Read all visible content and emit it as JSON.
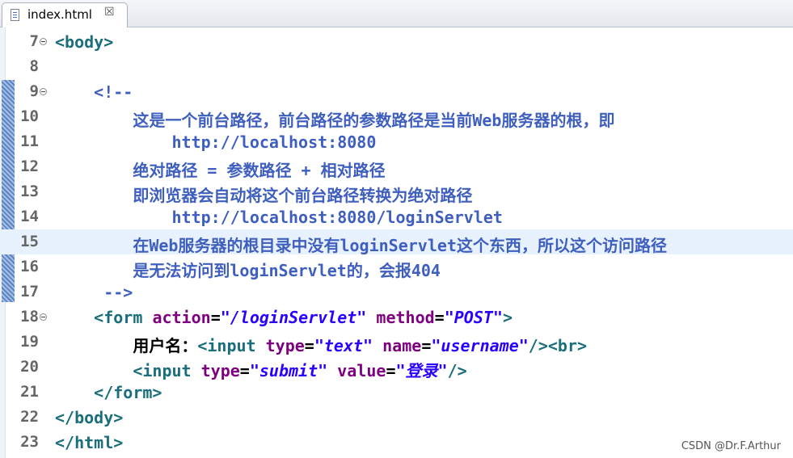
{
  "tab": {
    "label": "index.html",
    "close_glyph": "☒",
    "icon": "html-file-icon"
  },
  "lines": [
    {
      "num": "7",
      "fold": true
    },
    {
      "num": "8",
      "fold": false
    },
    {
      "num": "9",
      "fold": true
    },
    {
      "num": "10",
      "fold": false
    },
    {
      "num": "11",
      "fold": false
    },
    {
      "num": "12",
      "fold": false
    },
    {
      "num": "13",
      "fold": false
    },
    {
      "num": "14",
      "fold": false
    },
    {
      "num": "15",
      "fold": false,
      "current": true
    },
    {
      "num": "16",
      "fold": false
    },
    {
      "num": "17",
      "fold": false
    },
    {
      "num": "18",
      "fold": true
    },
    {
      "num": "19",
      "fold": false
    },
    {
      "num": "20",
      "fold": false
    },
    {
      "num": "21",
      "fold": false
    },
    {
      "num": "22",
      "fold": false
    },
    {
      "num": "23",
      "fold": false
    }
  ],
  "code": {
    "l7": {
      "open": "<body>"
    },
    "l9": {
      "comment_open": "<!--"
    },
    "l10": {
      "text": "这是一个前台路径，前台路径的参数路径是当前Web服务器的根，即"
    },
    "l11": {
      "text": "http://localhost:8080"
    },
    "l12": {
      "text": "绝对路径 = 参数路径 + 相对路径"
    },
    "l13": {
      "text": "即浏览器会自动将这个前台路径转换为绝对路径"
    },
    "l14": {
      "text": "http://localhost:8080/loginServlet"
    },
    "l15": {
      "text": "在Web服务器的根目录中没有loginServlet这个东西，所以这个访问路径"
    },
    "l16": {
      "text": "是无法访问到loginServlet的，会报404"
    },
    "l17": {
      "comment_close": "-->"
    },
    "l18": {
      "tag_open": "<form",
      "attr1": "action",
      "eq1": "=",
      "val1": "\"/loginServlet\"",
      "attr2": "method",
      "eq2": "=",
      "val2": "\"POST\"",
      "tag_close": ">"
    },
    "l19": {
      "label": "用户名：",
      "tag_open": "<input",
      "attr1": "type",
      "eq1": "=",
      "val1": "\"text\"",
      "attr2": "name",
      "eq2": "=",
      "val2": "\"username\"",
      "tag_close": "/><br>"
    },
    "l20": {
      "tag_open": "<input",
      "attr1": "type",
      "eq1": "=",
      "val1": "\"submit\"",
      "attr2": "value",
      "eq2": "=",
      "val2": "\"登录\"",
      "tag_close": "/>"
    },
    "l21": {
      "close": "</form>"
    },
    "l22": {
      "close": "</body>"
    },
    "l23": {
      "close": "</html>"
    }
  },
  "watermark": "CSDN @Dr.F.Arthur",
  "colors": {
    "tag": "#1a6f7a",
    "attribute": "#7f007f",
    "string": "#2a00ff",
    "comment": "#3f5fbf",
    "current_line": "#e8f2fe"
  }
}
